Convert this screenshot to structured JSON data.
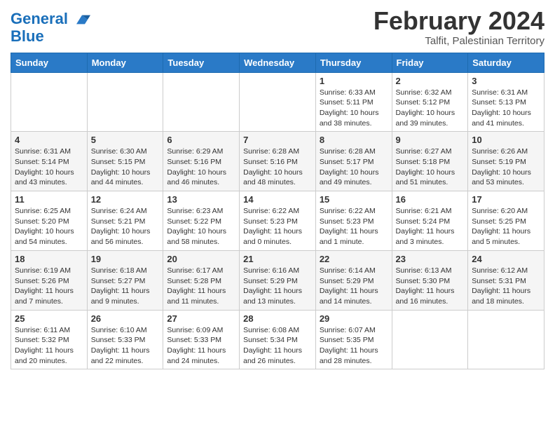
{
  "header": {
    "logo_line1": "General",
    "logo_line2": "Blue",
    "month_title": "February 2024",
    "location": "Talfit, Palestinian Territory"
  },
  "weekdays": [
    "Sunday",
    "Monday",
    "Tuesday",
    "Wednesday",
    "Thursday",
    "Friday",
    "Saturday"
  ],
  "weeks": [
    [
      {
        "day": "",
        "detail": ""
      },
      {
        "day": "",
        "detail": ""
      },
      {
        "day": "",
        "detail": ""
      },
      {
        "day": "",
        "detail": ""
      },
      {
        "day": "1",
        "detail": "Sunrise: 6:33 AM\nSunset: 5:11 PM\nDaylight: 10 hours\nand 38 minutes."
      },
      {
        "day": "2",
        "detail": "Sunrise: 6:32 AM\nSunset: 5:12 PM\nDaylight: 10 hours\nand 39 minutes."
      },
      {
        "day": "3",
        "detail": "Sunrise: 6:31 AM\nSunset: 5:13 PM\nDaylight: 10 hours\nand 41 minutes."
      }
    ],
    [
      {
        "day": "4",
        "detail": "Sunrise: 6:31 AM\nSunset: 5:14 PM\nDaylight: 10 hours\nand 43 minutes."
      },
      {
        "day": "5",
        "detail": "Sunrise: 6:30 AM\nSunset: 5:15 PM\nDaylight: 10 hours\nand 44 minutes."
      },
      {
        "day": "6",
        "detail": "Sunrise: 6:29 AM\nSunset: 5:16 PM\nDaylight: 10 hours\nand 46 minutes."
      },
      {
        "day": "7",
        "detail": "Sunrise: 6:28 AM\nSunset: 5:16 PM\nDaylight: 10 hours\nand 48 minutes."
      },
      {
        "day": "8",
        "detail": "Sunrise: 6:28 AM\nSunset: 5:17 PM\nDaylight: 10 hours\nand 49 minutes."
      },
      {
        "day": "9",
        "detail": "Sunrise: 6:27 AM\nSunset: 5:18 PM\nDaylight: 10 hours\nand 51 minutes."
      },
      {
        "day": "10",
        "detail": "Sunrise: 6:26 AM\nSunset: 5:19 PM\nDaylight: 10 hours\nand 53 minutes."
      }
    ],
    [
      {
        "day": "11",
        "detail": "Sunrise: 6:25 AM\nSunset: 5:20 PM\nDaylight: 10 hours\nand 54 minutes."
      },
      {
        "day": "12",
        "detail": "Sunrise: 6:24 AM\nSunset: 5:21 PM\nDaylight: 10 hours\nand 56 minutes."
      },
      {
        "day": "13",
        "detail": "Sunrise: 6:23 AM\nSunset: 5:22 PM\nDaylight: 10 hours\nand 58 minutes."
      },
      {
        "day": "14",
        "detail": "Sunrise: 6:22 AM\nSunset: 5:23 PM\nDaylight: 11 hours\nand 0 minutes."
      },
      {
        "day": "15",
        "detail": "Sunrise: 6:22 AM\nSunset: 5:23 PM\nDaylight: 11 hours\nand 1 minute."
      },
      {
        "day": "16",
        "detail": "Sunrise: 6:21 AM\nSunset: 5:24 PM\nDaylight: 11 hours\nand 3 minutes."
      },
      {
        "day": "17",
        "detail": "Sunrise: 6:20 AM\nSunset: 5:25 PM\nDaylight: 11 hours\nand 5 minutes."
      }
    ],
    [
      {
        "day": "18",
        "detail": "Sunrise: 6:19 AM\nSunset: 5:26 PM\nDaylight: 11 hours\nand 7 minutes."
      },
      {
        "day": "19",
        "detail": "Sunrise: 6:18 AM\nSunset: 5:27 PM\nDaylight: 11 hours\nand 9 minutes."
      },
      {
        "day": "20",
        "detail": "Sunrise: 6:17 AM\nSunset: 5:28 PM\nDaylight: 11 hours\nand 11 minutes."
      },
      {
        "day": "21",
        "detail": "Sunrise: 6:16 AM\nSunset: 5:29 PM\nDaylight: 11 hours\nand 13 minutes."
      },
      {
        "day": "22",
        "detail": "Sunrise: 6:14 AM\nSunset: 5:29 PM\nDaylight: 11 hours\nand 14 minutes."
      },
      {
        "day": "23",
        "detail": "Sunrise: 6:13 AM\nSunset: 5:30 PM\nDaylight: 11 hours\nand 16 minutes."
      },
      {
        "day": "24",
        "detail": "Sunrise: 6:12 AM\nSunset: 5:31 PM\nDaylight: 11 hours\nand 18 minutes."
      }
    ],
    [
      {
        "day": "25",
        "detail": "Sunrise: 6:11 AM\nSunset: 5:32 PM\nDaylight: 11 hours\nand 20 minutes."
      },
      {
        "day": "26",
        "detail": "Sunrise: 6:10 AM\nSunset: 5:33 PM\nDaylight: 11 hours\nand 22 minutes."
      },
      {
        "day": "27",
        "detail": "Sunrise: 6:09 AM\nSunset: 5:33 PM\nDaylight: 11 hours\nand 24 minutes."
      },
      {
        "day": "28",
        "detail": "Sunrise: 6:08 AM\nSunset: 5:34 PM\nDaylight: 11 hours\nand 26 minutes."
      },
      {
        "day": "29",
        "detail": "Sunrise: 6:07 AM\nSunset: 5:35 PM\nDaylight: 11 hours\nand 28 minutes."
      },
      {
        "day": "",
        "detail": ""
      },
      {
        "day": "",
        "detail": ""
      }
    ]
  ]
}
